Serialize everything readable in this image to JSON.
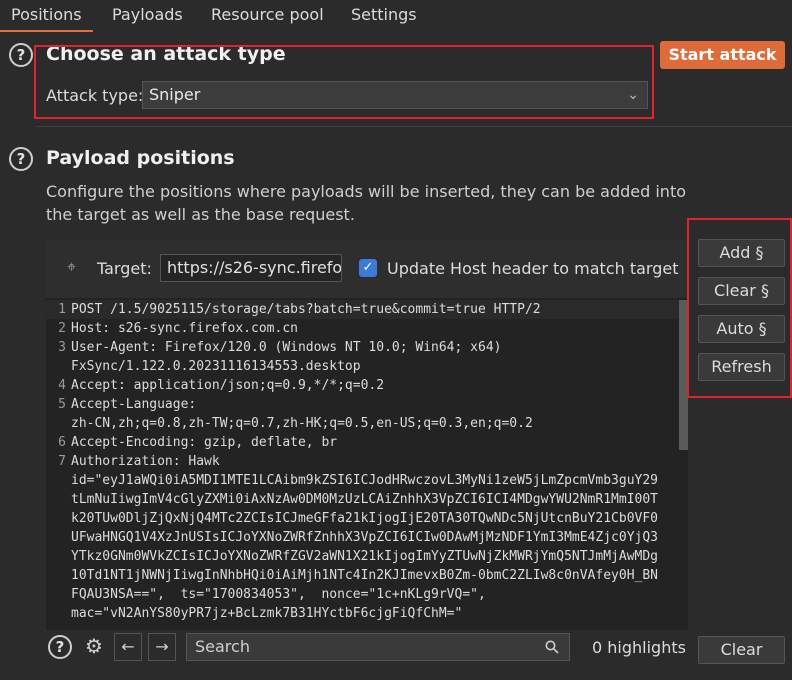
{
  "tabs": [
    {
      "label": "Positions",
      "active": true
    },
    {
      "label": "Payloads"
    },
    {
      "label": "Resource pool"
    },
    {
      "label": "Settings"
    }
  ],
  "attack": {
    "title": "Choose an attack type",
    "type_label": "Attack type:",
    "type_value": "Sniper",
    "start_button": "Start attack"
  },
  "positions": {
    "title": "Payload positions",
    "description": "Configure the positions where payloads will be inserted, they can be added into the target as well as the base request.",
    "target_label": "Target:",
    "target_value": "https://s26-sync.firefo",
    "update_host_label": "Update Host header to match target",
    "update_host_checked": true
  },
  "request_lines": [
    {
      "n": "1",
      "text": "POST /1.5/9025115/storage/tabs?batch=true&commit=true HTTP/2"
    },
    {
      "n": "2",
      "text": "Host: s26-sync.firefox.com.cn"
    },
    {
      "n": "3",
      "text": "User-Agent: Firefox/120.0 (Windows NT 10.0; Win64; x64)"
    },
    {
      "n": "",
      "text": "FxSync/1.122.0.20231116134553.desktop"
    },
    {
      "n": "4",
      "text": "Accept: application/json;q=0.9,*/*;q=0.2"
    },
    {
      "n": "5",
      "text": "Accept-Language:"
    },
    {
      "n": "",
      "text": "zh-CN,zh;q=0.8,zh-TW;q=0.7,zh-HK;q=0.5,en-US;q=0.3,en;q=0.2"
    },
    {
      "n": "6",
      "text": "Accept-Encoding: gzip, deflate, br"
    },
    {
      "n": "7",
      "text": "Authorization: Hawk"
    },
    {
      "n": "",
      "text": "id=\"eyJ1aWQi0iA5MDI1MTE1LCAibm9kZSI6ICJodHRwczovL3MyNi1zeW5jLmZpcmVmb3guY29"
    },
    {
      "n": "",
      "text": "tLmNuIiwgImV4cGlyZXMi0iAxNzAw0DM0MzUzLCAiZnhhX3VpZCI6ICI4MDgwYWU2NmR1MmI00T"
    },
    {
      "n": "",
      "text": "k20TUw0DljZjQxNjQ4MTc2ZCIsICJmeGFfa21kIjogIjE20TA30TQwNDc5NjUtcnBuY21Cb0VF0"
    },
    {
      "n": "",
      "text": "UFwaHNGQ1V4XzJnUSIsICJoYXNoZWRfZnhhX3VpZCI6ICIw0DAwMjMzNDF1YmI3MmE4Zjc0YjQ3"
    },
    {
      "n": "",
      "text": "YTkz0GNm0WVkZCIsICJoYXNoZWRfZGV2aWN1X21kIjogImYyZTUwNjZkMWRjYmQ5NTJmMjAwMDg"
    },
    {
      "n": "",
      "text": "10Td1NT1jNWNjIiwgInNhbHQi0iAiMjh1NTc4In2KJImevxB0Zm-0bmC2ZLIw8c0nVAfey0H_BN"
    },
    {
      "n": "",
      "text": "FQAU3NSA==\",  ts=\"1700834053\",  nonce=\"1c+nKLg9rVQ=\","
    },
    {
      "n": "",
      "text": "mac=\"vN2AnYS80yPR7jz+BcLzmk7B31HYctbF6cjgFiQfChM=\""
    }
  ],
  "side_buttons": {
    "add": "Add §",
    "clear": "Clear §",
    "auto": "Auto §",
    "refresh": "Refresh"
  },
  "search": {
    "placeholder": "Search",
    "highlights": "0 highlights"
  },
  "clear_button": "Clear"
}
